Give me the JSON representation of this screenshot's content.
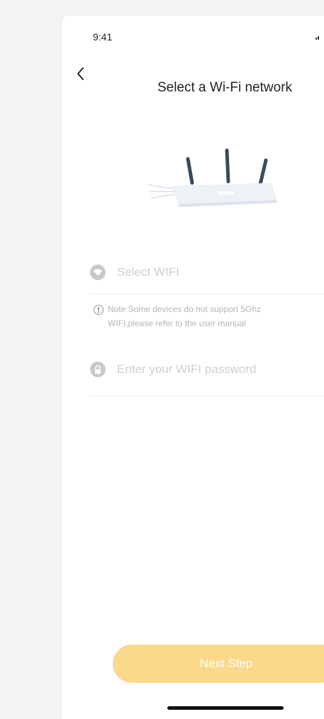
{
  "status_bar": {
    "time": "9:41"
  },
  "nav": {
    "title": "Select a Wi-Fi network",
    "back_icon": "chevron-left-icon"
  },
  "illustration": {
    "icon": "router-icon"
  },
  "wifi_field": {
    "placeholder": "Select WIFI",
    "icon": "wifi-icon"
  },
  "note": {
    "icon": "info-icon",
    "text_line1": "Note:Some devices do not support 5Ghz",
    "text_line2": "WIFI,please refer to the user manual"
  },
  "password_field": {
    "placeholder": "Enter your WIFI password",
    "icon": "lock-icon"
  },
  "actions": {
    "next_label": "Next Step"
  },
  "colors": {
    "primary_button": "#fbd98b",
    "placeholder_text": "#cfcfcf",
    "title_text": "#222222"
  }
}
